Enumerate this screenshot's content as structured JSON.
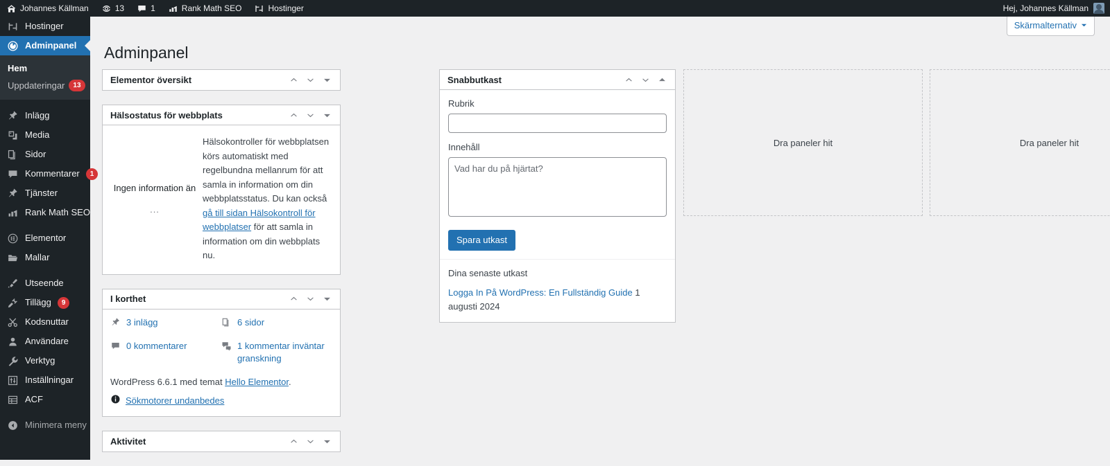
{
  "adminbar": {
    "site_name": "Johannes Källman",
    "site_icon": "home-icon",
    "updates_icon": "updates-icon",
    "updates_count": "13",
    "comments_icon": "comment-bubble-icon",
    "comments_count": "1",
    "rankmath_icon": "rank-math-icon",
    "rankmath_label": "Rank Math SEO",
    "hostinger_icon": "hostinger-icon",
    "hostinger_label": "Hostinger",
    "howdy": "Hej, Johannes Källman",
    "avatar_icon": "user-avatar"
  },
  "sidebar": {
    "items": [
      {
        "label": "Hostinger",
        "icon": "hostinger-icon",
        "current": false
      },
      {
        "label": "Adminpanel",
        "icon": "dashboard-icon",
        "current": true
      }
    ],
    "submenu": [
      {
        "label": "Hem",
        "current": true,
        "badge": ""
      },
      {
        "label": "Uppdateringar",
        "current": false,
        "badge": "13"
      }
    ],
    "group2": [
      {
        "label": "Inlägg",
        "icon": "pin-icon",
        "badge": ""
      },
      {
        "label": "Media",
        "icon": "media-icon",
        "badge": ""
      },
      {
        "label": "Sidor",
        "icon": "pages-icon",
        "badge": ""
      },
      {
        "label": "Kommentarer",
        "icon": "comment-bubble-icon",
        "badge": "1"
      },
      {
        "label": "Tjänster",
        "icon": "pin-icon",
        "badge": ""
      },
      {
        "label": "Rank Math SEO",
        "icon": "rank-math-icon",
        "badge": ""
      }
    ],
    "group3": [
      {
        "label": "Elementor",
        "icon": "elementor-icon",
        "badge": ""
      },
      {
        "label": "Mallar",
        "icon": "folder-icon",
        "badge": ""
      }
    ],
    "group4": [
      {
        "label": "Utseende",
        "icon": "brush-icon",
        "badge": ""
      },
      {
        "label": "Tillägg",
        "icon": "plugin-icon",
        "badge": "9"
      },
      {
        "label": "Kodsnuttar",
        "icon": "scissors-icon",
        "badge": ""
      },
      {
        "label": "Användare",
        "icon": "user-icon",
        "badge": ""
      },
      {
        "label": "Verktyg",
        "icon": "wrench-icon",
        "badge": ""
      },
      {
        "label": "Inställningar",
        "icon": "settings-icon",
        "badge": ""
      },
      {
        "label": "ACF",
        "icon": "acf-icon",
        "badge": ""
      }
    ],
    "collapse": {
      "label": "Minimera meny",
      "icon": "collapse-arrow-icon"
    }
  },
  "screen_meta": {
    "label": "Skärmalternativ",
    "caret_icon": "chevron-down-icon"
  },
  "page": {
    "title": "Adminpanel"
  },
  "widget_controls": {
    "up_icon": "chevron-up-icon",
    "down_icon": "chevron-down-icon",
    "toggle_icon": "toggle-triangle-icon"
  },
  "elementor_overview": {
    "title": "Elementor översikt"
  },
  "site_health": {
    "title": "Hälsostatus för webbplats",
    "status_label": "Ingen information än",
    "loading_dots": "...",
    "body_1": "Hälsokontroller för webbplatsen körs automatiskt med regelbundna mellanrum för att samla in information om din webbplatsstatus. Du kan också ",
    "link": "gå till sidan Hälsokontroll för webbplatser",
    "body_2": " för att samla in information om din webbplats nu."
  },
  "at_a_glance": {
    "title": "I korthet",
    "items": [
      {
        "label": "3 inlägg",
        "icon": "pin-icon"
      },
      {
        "label": "6 sidor",
        "icon": "pages-icon"
      },
      {
        "label": "0 kommentarer",
        "icon": "comment-bubble-icon"
      },
      {
        "label": "1 kommentar inväntar granskning",
        "icon": "comments-moderate-icon"
      }
    ],
    "version_prefix": "WordPress 6.6.1 med temat ",
    "theme_link": "Hello Elementor",
    "version_suffix": ".",
    "seo_notice": "Sökmotorer undanbedes",
    "seo_icon": "info-icon"
  },
  "activity": {
    "title": "Aktivitet"
  },
  "quick_draft": {
    "title": "Snabbutkast",
    "title_label": "Rubrik",
    "title_value": "",
    "title_placeholder": "",
    "content_label": "Innehåll",
    "content_value": "",
    "content_placeholder": "Vad har du på hjärtat?",
    "save_label": "Spara utkast",
    "drafts_heading": "Dina senaste utkast",
    "drafts": [
      {
        "title": "Logga In På WordPress: En Fullständig Guide",
        "date": "1 augusti 2024"
      }
    ]
  },
  "empty_containers": [
    {
      "label": "Dra paneler hit"
    },
    {
      "label": "Dra paneler hit"
    }
  ],
  "colors": {
    "admin_bar": "#1d2327",
    "sidebar": "#1d2327",
    "accent": "#2271b1",
    "badge": "#d63638",
    "background": "#f0f0f1",
    "border": "#c3c4c7"
  }
}
